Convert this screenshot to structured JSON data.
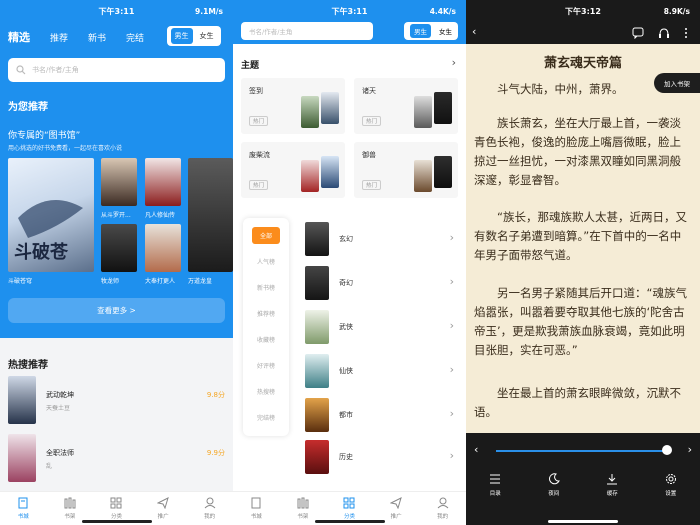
{
  "colors": {
    "primary": "#1e90ee",
    "accent": "#fb8c1c",
    "score": "#f5a623",
    "reader_bg": "#f5ecd6",
    "dark": "#1a1a1a"
  },
  "panel1": {
    "status": {
      "time": "下午3:11",
      "speed": "9.1M/s"
    },
    "nav": [
      "精选",
      "推荐",
      "新书",
      "完结"
    ],
    "gender": [
      "男生",
      "女生"
    ],
    "search_placeholder": "书名/作者/主角",
    "recommend_title": "为您推荐",
    "library_title": "你专属的“图书馆”",
    "library_desc": "用心挑选的好书免费看，一起尽在喜欢小说",
    "books": [
      {
        "title": "斗破苍穹"
      },
      {
        "title": "从斗罗开..."
      },
      {
        "title": "凡人修仙传"
      },
      {
        "title": "牧龙师"
      },
      {
        "title": "大奉打更人"
      },
      {
        "title": "万道龙皇"
      }
    ],
    "more_button": "查看更多 >",
    "hot_title": "热搜推荐",
    "hot": [
      {
        "name": "武动乾坤",
        "author": "天蚕土豆",
        "score": "9.8分"
      },
      {
        "name": "全职法师",
        "author": "乱",
        "score": "9.9分"
      }
    ],
    "tabs": [
      "书城",
      "书架",
      "分类",
      "推广",
      "我的"
    ]
  },
  "panel2": {
    "status": {
      "time": "下午3:11",
      "speed": "4.4K/s"
    },
    "search_placeholder": "书名/作者/主角",
    "gender": [
      "男生",
      "女生"
    ],
    "theme_title": "主题",
    "themes": [
      {
        "name": "签到",
        "badge": "热门"
      },
      {
        "name": "诸天",
        "badge": "热门"
      },
      {
        "name": "废柴流",
        "badge": "热门"
      },
      {
        "name": "御兽",
        "badge": "热门"
      }
    ],
    "categories": [
      "全部",
      "人气榜",
      "新书榜",
      "推荐榜",
      "收藏榜",
      "好评榜",
      "热搜榜",
      "完结榜"
    ],
    "genres": [
      "玄幻",
      "奇幻",
      "武侠",
      "仙侠",
      "都市",
      "历史"
    ],
    "tabs": [
      "书城",
      "书架",
      "分类",
      "推广",
      "我的"
    ]
  },
  "panel3": {
    "status": {
      "time": "下午3:12",
      "speed": "8.9K/s"
    },
    "chapter_title": "萧玄魂天帝篇",
    "add_shelf": "加入书架",
    "paragraphs": [
      "斗气大陆，中州，萧界。",
      "族长萧玄，坐在大厅最上首，一袭淡青色长袍，俊逸的脸庞上嘴唇微眠，脸上掠过一丝担忧，一对漆黑双瞳如同黑洞般深邃，彰显睿智。",
      "“族长，那魂族欺人太甚，近两日，又有数名子弟遭到暗算。”在下首中的一名中年男子面带怒气道。",
      "另一名男子紧随其后开口道：“魂族气焰嚣张，叫嚣着要夺取其他七族的‘陀舍古帝玉’，更是欺我萧族血脉衰竭，竟如此明目张胆，实在可恶。”",
      "坐在最上首的萧玄眼眸微敛，沉默不语。"
    ],
    "tabs": [
      "目录",
      "夜间",
      "缓存",
      "设置"
    ]
  }
}
